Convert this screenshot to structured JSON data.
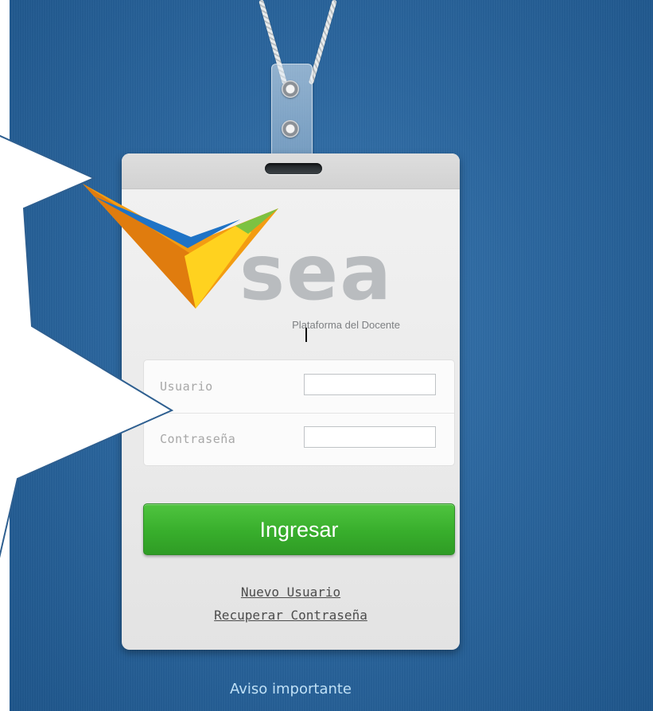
{
  "logo": {
    "wordmark": "sea",
    "subtitle": "Plataforma del Docente",
    "icon": "check-chevron-logo"
  },
  "login": {
    "username_label": "Usuario",
    "username_value": "",
    "password_label": "Contraseña",
    "password_value": "",
    "submit_label": "Ingresar"
  },
  "links": {
    "new_user": "Nuevo Usuario",
    "recover_password": "Recuperar Contraseña",
    "notice": "Aviso importante"
  },
  "colors": {
    "background": "#2c679f",
    "button_green": "#38ae2c",
    "logo_orange": "#f39c12",
    "logo_yellow": "#ffd21f",
    "logo_blue": "#1f73c6",
    "logo_green": "#7cc242"
  }
}
